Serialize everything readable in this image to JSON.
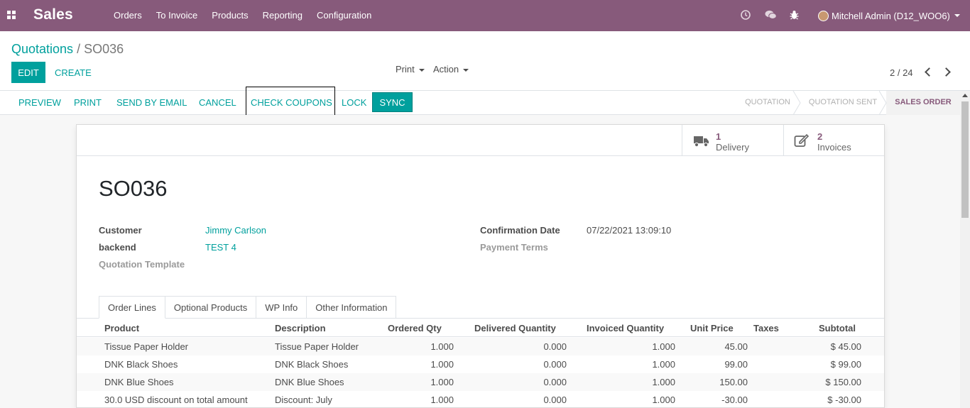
{
  "navbar": {
    "app_name": "Sales",
    "menu": [
      "Orders",
      "To Invoice",
      "Products",
      "Reporting",
      "Configuration"
    ],
    "icons": [
      "clock-icon",
      "chat-icon",
      "bug-icon"
    ],
    "user": "Mitchell Admin (D12_WOO6)"
  },
  "breadcrumb": {
    "parent": "Quotations",
    "separator": "/",
    "current": "SO036"
  },
  "control": {
    "edit": "EDIT",
    "create": "CREATE",
    "print": "Print",
    "action": "Action",
    "pager": "2 / 24"
  },
  "statusbar": {
    "buttons": [
      "PREVIEW",
      "PRINT",
      "SEND BY EMAIL",
      "CANCEL",
      "CHECK COUPONS",
      "LOCK"
    ],
    "sync": "SYNC",
    "stages": [
      "QUOTATION",
      "QUOTATION SENT",
      "SALES ORDER"
    ],
    "active_stage": "SALES ORDER"
  },
  "smart_buttons": [
    {
      "count": "1",
      "label": "Delivery",
      "icon": "truck-icon"
    },
    {
      "count": "2",
      "label": "Invoices",
      "icon": "pencil-square-icon"
    }
  ],
  "record": {
    "name": "SO036",
    "customer_label": "Customer",
    "customer": "Jimmy Carlson",
    "backend_label": "backend",
    "backend": "TEST 4",
    "template_label": "Quotation Template",
    "confirmation_label": "Confirmation Date",
    "confirmation_date": "07/22/2021 13:09:10",
    "payment_terms_label": "Payment Terms"
  },
  "tabs": [
    "Order Lines",
    "Optional Products",
    "WP Info",
    "Other Information"
  ],
  "order_lines": {
    "columns": [
      "Product",
      "Description",
      "Ordered Qty",
      "Delivered Quantity",
      "Invoiced Quantity",
      "Unit Price",
      "Taxes",
      "Subtotal"
    ],
    "rows": [
      [
        "Tissue Paper Holder",
        "Tissue Paper Holder",
        "1.000",
        "0.000",
        "1.000",
        "45.00",
        "",
        "$ 45.00"
      ],
      [
        "DNK Black Shoes",
        "DNK Black Shoes",
        "1.000",
        "0.000",
        "1.000",
        "99.00",
        "",
        "$ 99.00"
      ],
      [
        "DNK Blue Shoes",
        "DNK Blue Shoes",
        "1.000",
        "0.000",
        "1.000",
        "150.00",
        "",
        "$ 150.00"
      ],
      [
        "30.0 USD discount on total amount",
        "Discount: July",
        "1.000",
        "0.000",
        "1.000",
        "-30.00",
        "",
        "$ -30.00"
      ]
    ]
  },
  "colors": {
    "brand": "#875a7b",
    "accent": "#00a09d"
  }
}
